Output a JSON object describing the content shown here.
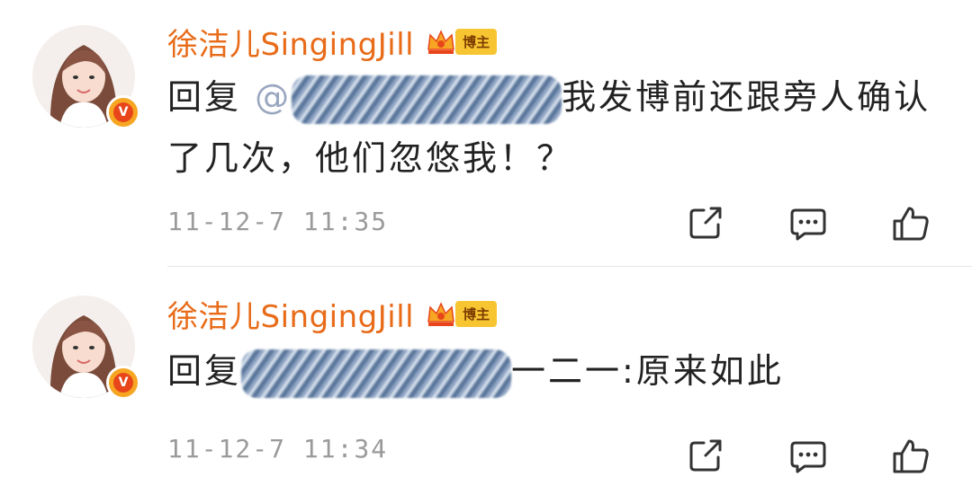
{
  "comments": [
    {
      "username": "徐洁儿SingingJill",
      "badge": "博主",
      "reply_prefix": "回复",
      "mention_visible": "@",
      "text_after": "我发博前还跟旁人确认了几次，他们忽悠我！？",
      "time": "11-12-7 11:35",
      "colors": {
        "name": "#e86b18",
        "meta": "#9a9a9a"
      }
    },
    {
      "username": "徐洁儿SingingJill",
      "badge": "博主",
      "reply_prefix": "回复",
      "mention_visible": "",
      "text_after": "一二一:原来如此",
      "time": "11-12-7 11:34",
      "colors": {
        "name": "#e86b18",
        "meta": "#9a9a9a"
      }
    }
  ],
  "icons": {
    "share": "share-icon",
    "comment": "comment-icon",
    "like": "thumbs-up-icon",
    "verified": "verified-v-icon",
    "crown": "crown-icon"
  }
}
